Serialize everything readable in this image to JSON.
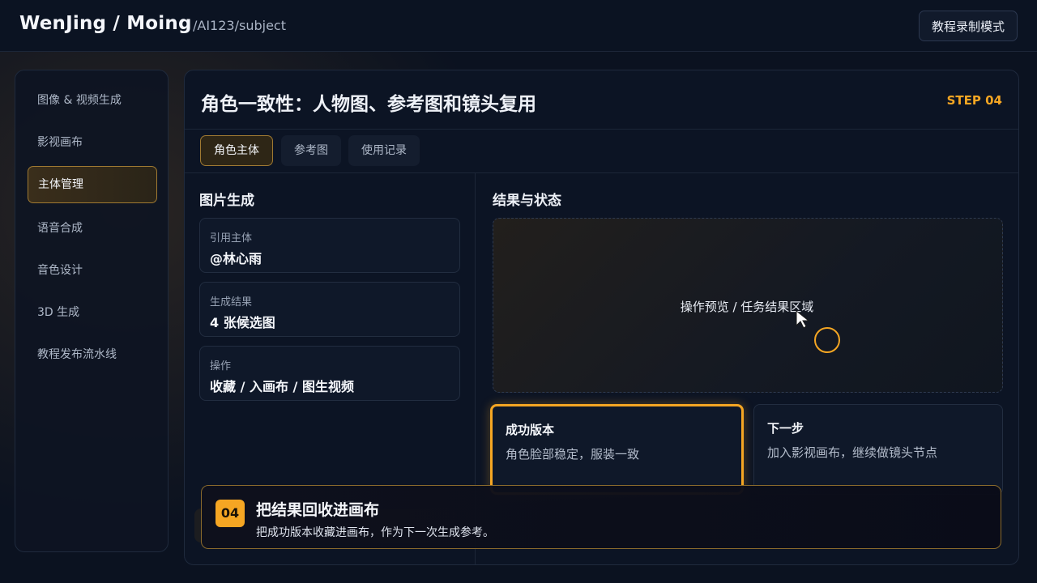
{
  "header": {
    "brand": "WenJing / Moing",
    "path": "/AI123/subject",
    "mode_button": "教程录制模式"
  },
  "sidebar": {
    "items": [
      {
        "label": "图像 & 视频生成",
        "active": false
      },
      {
        "label": "影视画布",
        "active": false
      },
      {
        "label": "主体管理",
        "active": true
      },
      {
        "label": "语音合成",
        "active": false
      },
      {
        "label": "音色设计",
        "active": false
      },
      {
        "label": "3D 生成",
        "active": false
      },
      {
        "label": "教程发布流水线",
        "active": false
      }
    ]
  },
  "main": {
    "title": "角色一致性：人物图、参考图和镜头复用",
    "step": "STEP 04",
    "tabs": [
      {
        "label": "角色主体",
        "active": true
      },
      {
        "label": "参考图",
        "active": false
      },
      {
        "label": "使用记录",
        "active": false
      }
    ],
    "left_panel": {
      "title": "图片生成",
      "cards": [
        {
          "label": "引用主体",
          "value": "@林心雨"
        },
        {
          "label": "生成结果",
          "value": "4 张候选图"
        },
        {
          "label": "操作",
          "value": "收藏 / 入画布 / 图生视频"
        }
      ]
    },
    "right_panel": {
      "title": "结果与状态",
      "preview_text": "操作预览 / 任务结果区域",
      "result_cards": [
        {
          "title": "成功版本",
          "desc": "角色脸部稳定，服装一致",
          "highlight": true
        },
        {
          "title": "下一步",
          "desc": "加入影视画布，继续做镜头节点",
          "highlight": false
        }
      ]
    }
  },
  "toast": {
    "badge": "04",
    "title": "把结果回收进画布",
    "desc": "把成功版本收藏进画布，作为下一次生成参考。"
  },
  "colors": {
    "accent": "#f5a623",
    "background": "#0b1220",
    "panel": "#0c1424"
  }
}
